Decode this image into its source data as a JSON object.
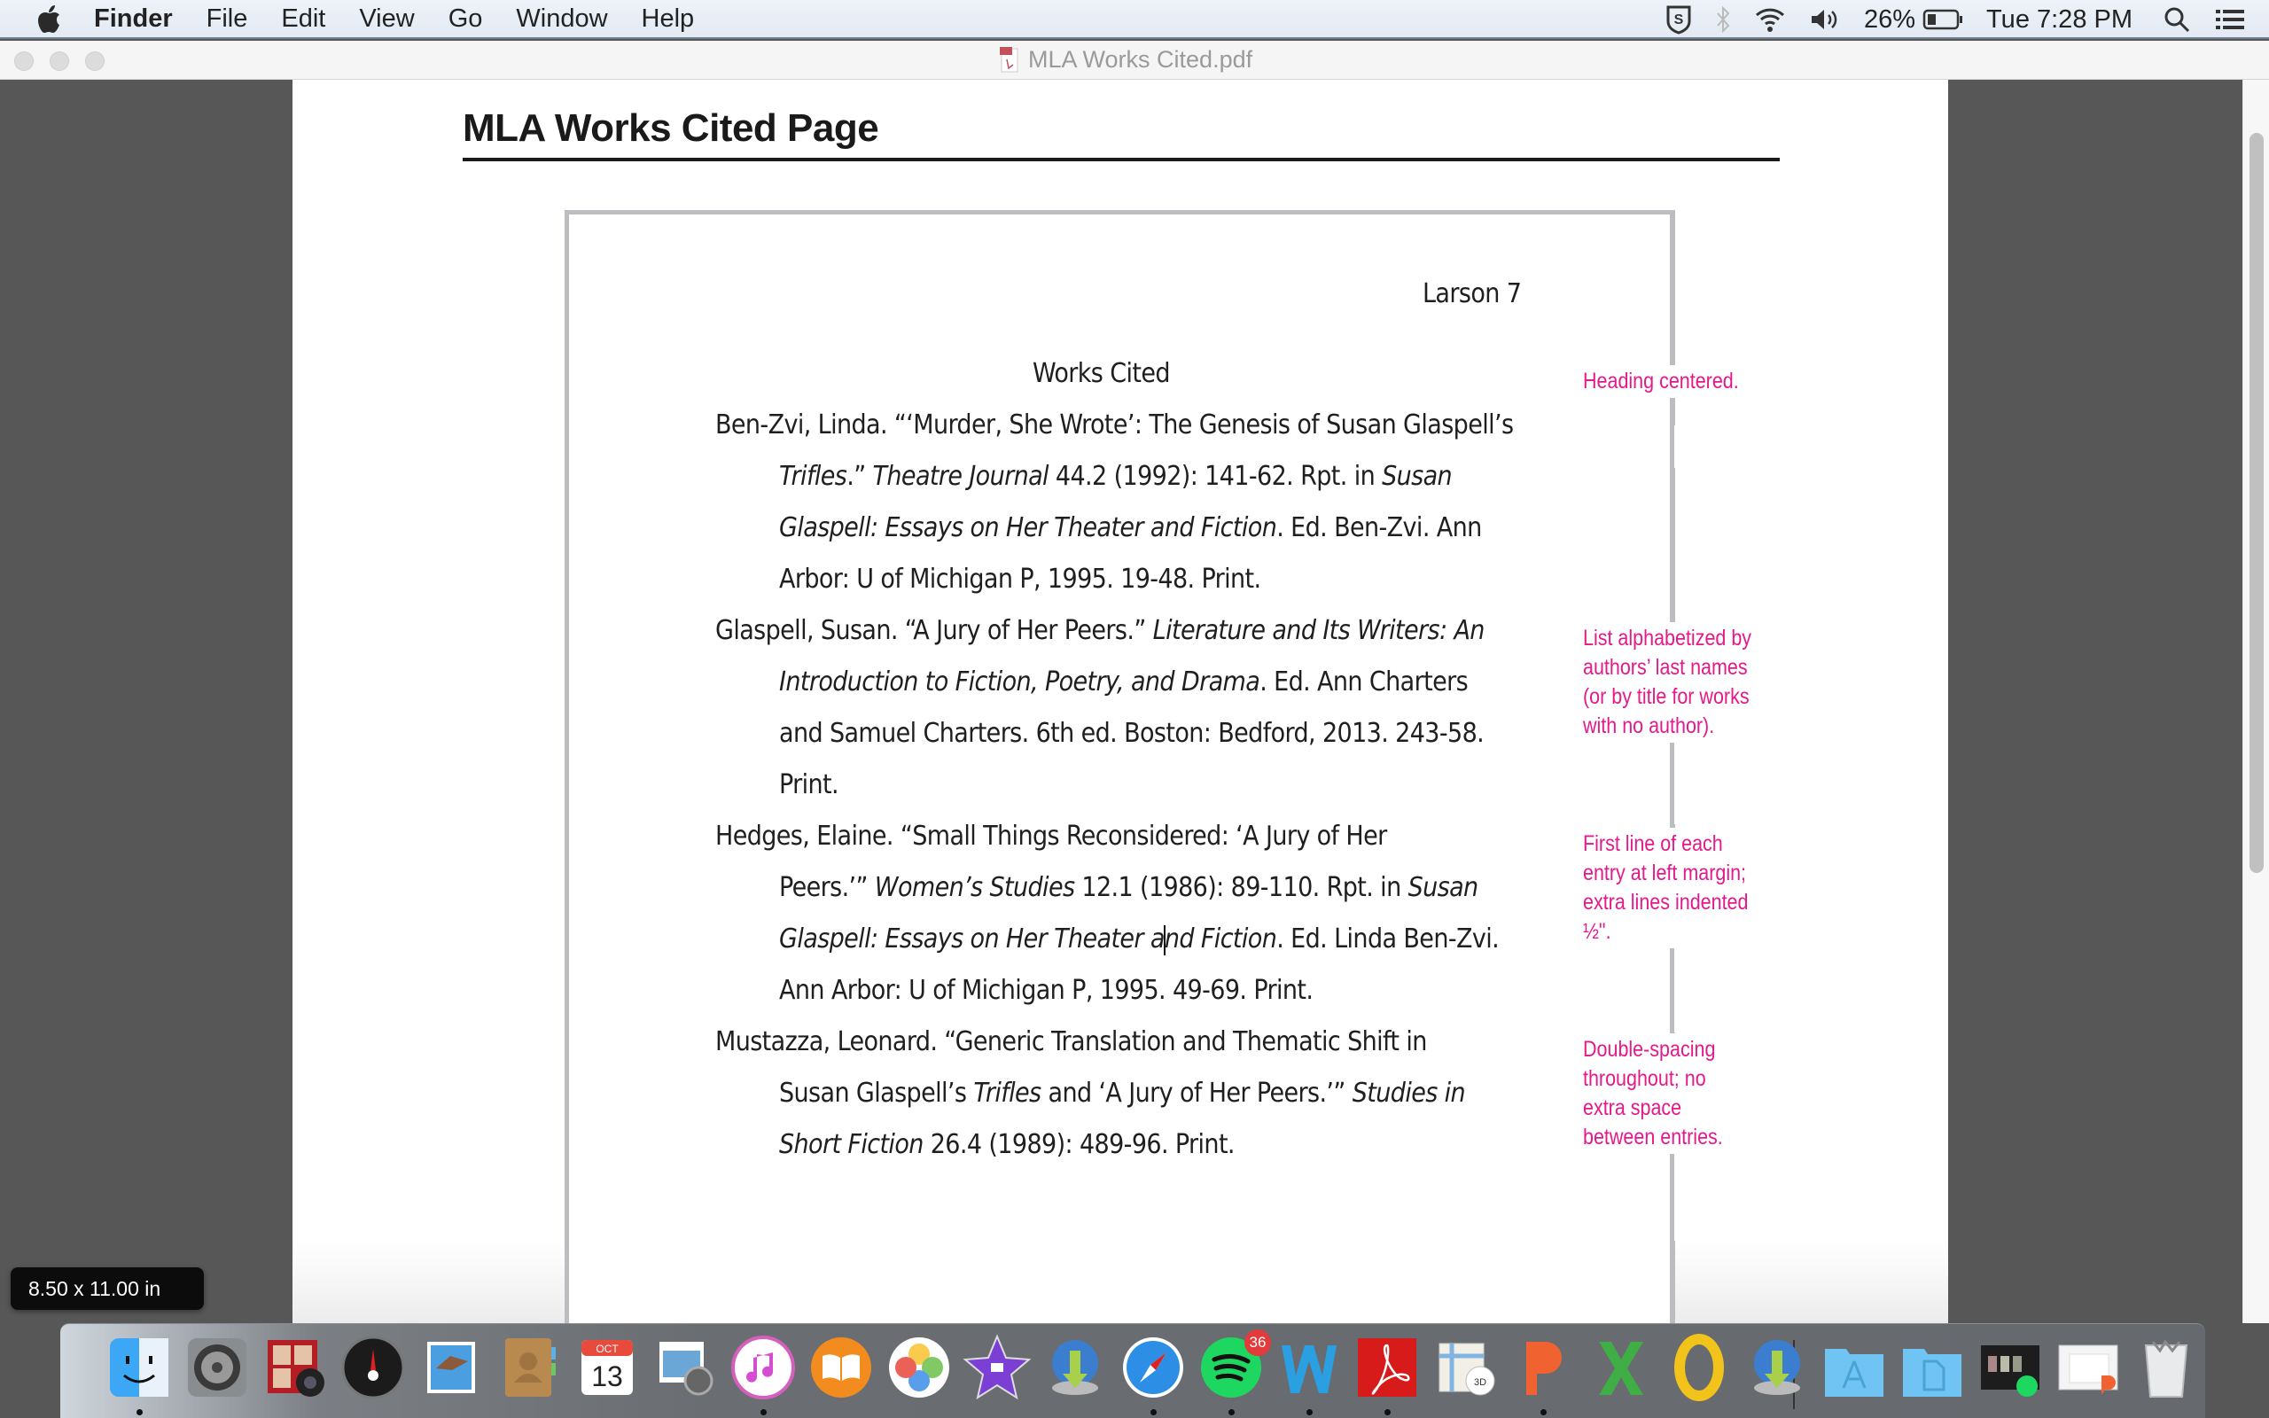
{
  "menubar": {
    "app_name": "Finder",
    "items": [
      "File",
      "Edit",
      "View",
      "Go",
      "Window",
      "Help"
    ],
    "status": {
      "battery_percent": "26%",
      "clock": "Tue 7:28 PM"
    },
    "icons": [
      "apple-icon",
      "sophos-shield-icon",
      "bluetooth-icon",
      "wifi-icon",
      "volume-icon",
      "battery-icon",
      "spotlight-search-icon",
      "notification-center-icon"
    ]
  },
  "window": {
    "title": "MLA Works Cited.pdf",
    "page_size_hud": "8.50 x 11.00 in"
  },
  "document": {
    "heading": "MLA Works Cited Page",
    "running_head": "Larson 7",
    "section_title": "Works Cited",
    "entries": [
      {
        "lines": [
          [
            {
              "t": "Ben-Zvi, Linda. “‘Murder, She Wrote’: The Genesis of Susan Glaspell’s",
              "i": false
            }
          ],
          [
            {
              "t": "Trifles",
              "i": true
            },
            {
              "t": ".” ",
              "i": false
            },
            {
              "t": "Theatre Journal",
              "i": true
            },
            {
              "t": " 44.2 (1992): 141-62. Rpt. in ",
              "i": false
            },
            {
              "t": "Susan",
              "i": true
            }
          ],
          [
            {
              "t": "Glaspell: Essays on Her Theater and Fiction",
              "i": true
            },
            {
              "t": ". Ed. Ben-Zvi. Ann",
              "i": false
            }
          ],
          [
            {
              "t": "Arbor: U of Michigan P, 1995. 19-48. Print.",
              "i": false
            }
          ]
        ]
      },
      {
        "lines": [
          [
            {
              "t": "Glaspell, Susan. “A Jury of Her Peers.” ",
              "i": false
            },
            {
              "t": "Literature and Its Writers: An",
              "i": true
            }
          ],
          [
            {
              "t": "Introduction to Fiction, Poetry, and Drama",
              "i": true
            },
            {
              "t": ". Ed. Ann Charters",
              "i": false
            }
          ],
          [
            {
              "t": "and Samuel Charters. 6th ed. Boston: Bedford, 2013. 243-58.",
              "i": false
            }
          ],
          [
            {
              "t": "Print.",
              "i": false
            }
          ]
        ]
      },
      {
        "lines": [
          [
            {
              "t": "Hedges, Elaine. “Small Things Reconsidered: ‘A Jury of Her",
              "i": false
            }
          ],
          [
            {
              "t": "Peers.’” ",
              "i": false
            },
            {
              "t": "Women’s Studies",
              "i": true
            },
            {
              "t": " 12.1 (1986): 89-110. Rpt. in ",
              "i": false
            },
            {
              "t": "Susan",
              "i": true
            }
          ],
          [
            {
              "t": "Glaspell: Essays on Her Theater a",
              "i": true
            },
            {
              "t": "|caret|",
              "i": false
            },
            {
              "t": "nd Fiction",
              "i": true
            },
            {
              "t": ". Ed. Linda Ben-Zvi.",
              "i": false
            }
          ],
          [
            {
              "t": "Ann Arbor: U of Michigan P, 1995. 49-69. Print.",
              "i": false
            }
          ]
        ]
      },
      {
        "lines": [
          [
            {
              "t": "Mustazza, Leonard. “Generic Translation and Thematic Shift in",
              "i": false
            }
          ],
          [
            {
              "t": "Susan Glaspell’s ",
              "i": false
            },
            {
              "t": "Trifles",
              "i": true
            },
            {
              "t": " and ‘A Jury of Her Peers.’” ",
              "i": false
            },
            {
              "t": "Studies in",
              "i": true
            }
          ],
          [
            {
              "t": "Short Fiction",
              "i": true
            },
            {
              "t": " 26.4 (1989): 489-96. Print.",
              "i": false
            }
          ]
        ]
      }
    ],
    "annotations": [
      "Heading centered.",
      "List alphabetized by\nauthors’ last names\n(or by title for works\nwith no author).",
      "First line of each\nentry at left margin;\nextra lines indented\n½\".",
      "Double-spacing\nthroughout; no\nextra space\nbetween entries."
    ],
    "annotation_color": "#e4198b"
  },
  "dock": {
    "items": [
      {
        "name": "Finder",
        "running": true
      },
      {
        "name": "System Preferences",
        "running": false
      },
      {
        "name": "Photo Booth",
        "running": false
      },
      {
        "name": "Dashboard",
        "running": false
      },
      {
        "name": "Mail",
        "running": false
      },
      {
        "name": "Contacts",
        "running": false
      },
      {
        "name": "Calendar",
        "running": false,
        "month": "OCT",
        "day": "13"
      },
      {
        "name": "Preview",
        "running": false
      },
      {
        "name": "iTunes",
        "running": true
      },
      {
        "name": "iBooks",
        "running": false
      },
      {
        "name": "Photos",
        "running": false
      },
      {
        "name": "iMovie",
        "running": false
      },
      {
        "name": "Downloader",
        "running": false
      },
      {
        "name": "Safari",
        "running": true
      },
      {
        "name": "Spotify",
        "running": true,
        "badge": "36"
      },
      {
        "name": "Microsoft Word",
        "running": true
      },
      {
        "name": "Adobe Acrobat",
        "running": true
      },
      {
        "name": "Maps",
        "running": false
      },
      {
        "name": "Microsoft PowerPoint",
        "running": true
      },
      {
        "name": "Microsoft Excel",
        "running": false
      },
      {
        "name": "Microsoft Outlook",
        "running": false
      },
      {
        "name": "Downloader 2",
        "running": false
      },
      {
        "name": "Applications",
        "running": false
      },
      {
        "name": "Documents",
        "running": false
      },
      {
        "name": "Spotify window",
        "running": false
      },
      {
        "name": "PowerPoint window",
        "running": false
      },
      {
        "name": "Trash",
        "running": false
      }
    ]
  }
}
